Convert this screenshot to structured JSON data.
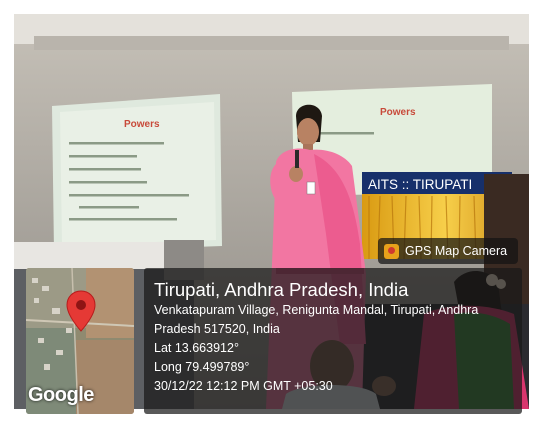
{
  "slide_left": {
    "title": "Powers"
  },
  "slide_right": {
    "title": "Powers"
  },
  "banner": {
    "text": "AITS :: TIRUPATI"
  },
  "gps_chip": {
    "label": "GPS Map Camera",
    "icon": "gps-map-camera-logo"
  },
  "map": {
    "watermark": "Google",
    "pin_color": "#e53935"
  },
  "location": {
    "city": "Tirupati, Andhra Pradesh, India",
    "address_line1": "Venkatapuram Village, Renigunta Mandal, Tirupati, Andhra",
    "address_line2": "Pradesh 517520, India",
    "lat": "Lat 13.663912°",
    "long": "Long 79.499789°",
    "datetime": "30/12/22 12:12 PM GMT +05:30"
  }
}
